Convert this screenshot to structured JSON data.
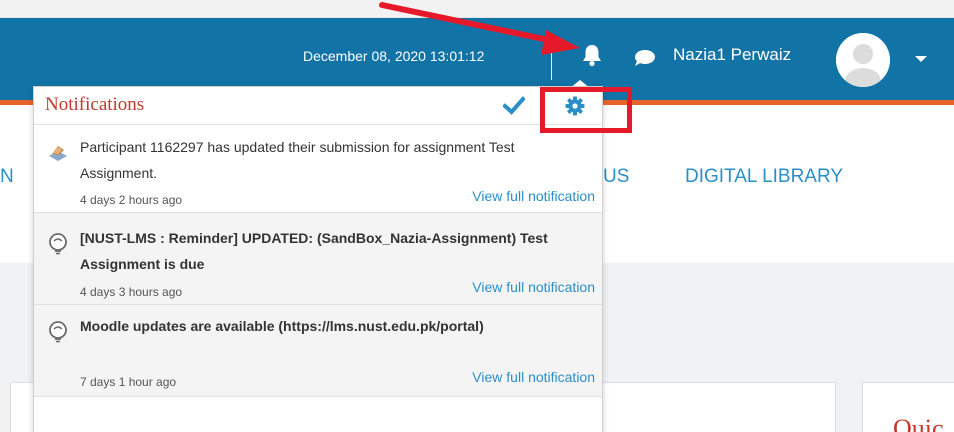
{
  "header": {
    "datetime": "December 08, 2020 13:01:12",
    "user_name": "Nazia1 Perwaiz"
  },
  "background_menu": {
    "partial_left": "N",
    "partial_mid": "US",
    "digital_library": "DIGITAL LIBRARY"
  },
  "quick_label": "Quic",
  "notifications": {
    "title": "Notifications",
    "items": [
      {
        "text": "Participant 1162297 has updated their submission for assignment Test Assignment.",
        "time": "4 days 2 hours ago",
        "link": "View full notification",
        "icon": "assignment-icon"
      },
      {
        "text": "[NUST-LMS : Reminder] UPDATED: (SandBox_Nazia-Assignment) Test Assignment is due",
        "time": "4 days 3 hours ago",
        "link": "View full notification",
        "icon": "lightbulb-icon"
      },
      {
        "text": "Moodle updates are available (https://lms.nust.edu.pk/portal)",
        "time": "7 days 1 hour ago",
        "link": "View full notification",
        "icon": "lightbulb-icon"
      }
    ]
  },
  "colors": {
    "navbar": "#1273a6",
    "accent_orange": "#e8622c",
    "link_blue": "#2b8fc7",
    "title_red": "#c0392b",
    "annotation_red": "#e5192a"
  }
}
